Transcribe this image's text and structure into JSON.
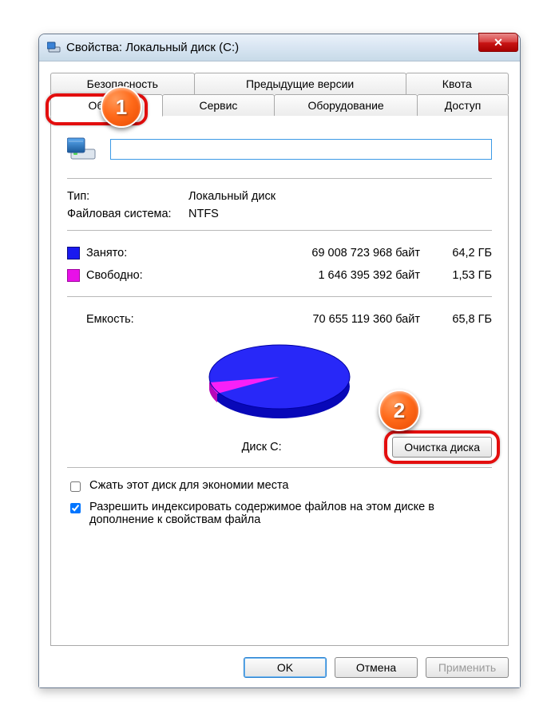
{
  "window": {
    "title": "Свойства: Локальный диск (C:)"
  },
  "tabs": {
    "row1": [
      "Безопасность",
      "Предыдущие версии",
      "Квота"
    ],
    "row2": [
      "Общие",
      "Сервис",
      "Оборудование",
      "Доступ"
    ],
    "active": "Общие"
  },
  "badges": {
    "one": "1",
    "two": "2"
  },
  "info": {
    "type_label": "Тип:",
    "type_value": "Локальный диск",
    "fs_label": "Файловая система:",
    "fs_value": "NTFS"
  },
  "space": {
    "used_label": "Занято:",
    "used_bytes": "69 008 723 968 байт",
    "used_gb": "64,2 ГБ",
    "free_label": "Свободно:",
    "free_bytes": "1 646 395 392 байт",
    "free_gb": "1,53 ГБ",
    "cap_label": "Емкость:",
    "cap_bytes": "70 655 119 360 байт",
    "cap_gb": "65,8 ГБ"
  },
  "pie_label": "Диск C:",
  "cleanup_button": "Очистка диска",
  "checks": {
    "compress": "Сжать этот диск для экономии места",
    "index": "Разрешить индексировать содержимое файлов на этом диске в дополнение к свойствам файла"
  },
  "buttons": {
    "ok": "OK",
    "cancel": "Отмена",
    "apply": "Применить"
  },
  "chart_data": {
    "type": "pie",
    "title": "Диск C:",
    "series": [
      {
        "name": "Занято",
        "value_gb": 64.2,
        "value_bytes": 69008723968,
        "color": "#1a1af0"
      },
      {
        "name": "Свободно",
        "value_gb": 1.53,
        "value_bytes": 1646395392,
        "color": "#e810e8"
      }
    ],
    "total_gb": 65.8,
    "total_bytes": 70655119360
  }
}
